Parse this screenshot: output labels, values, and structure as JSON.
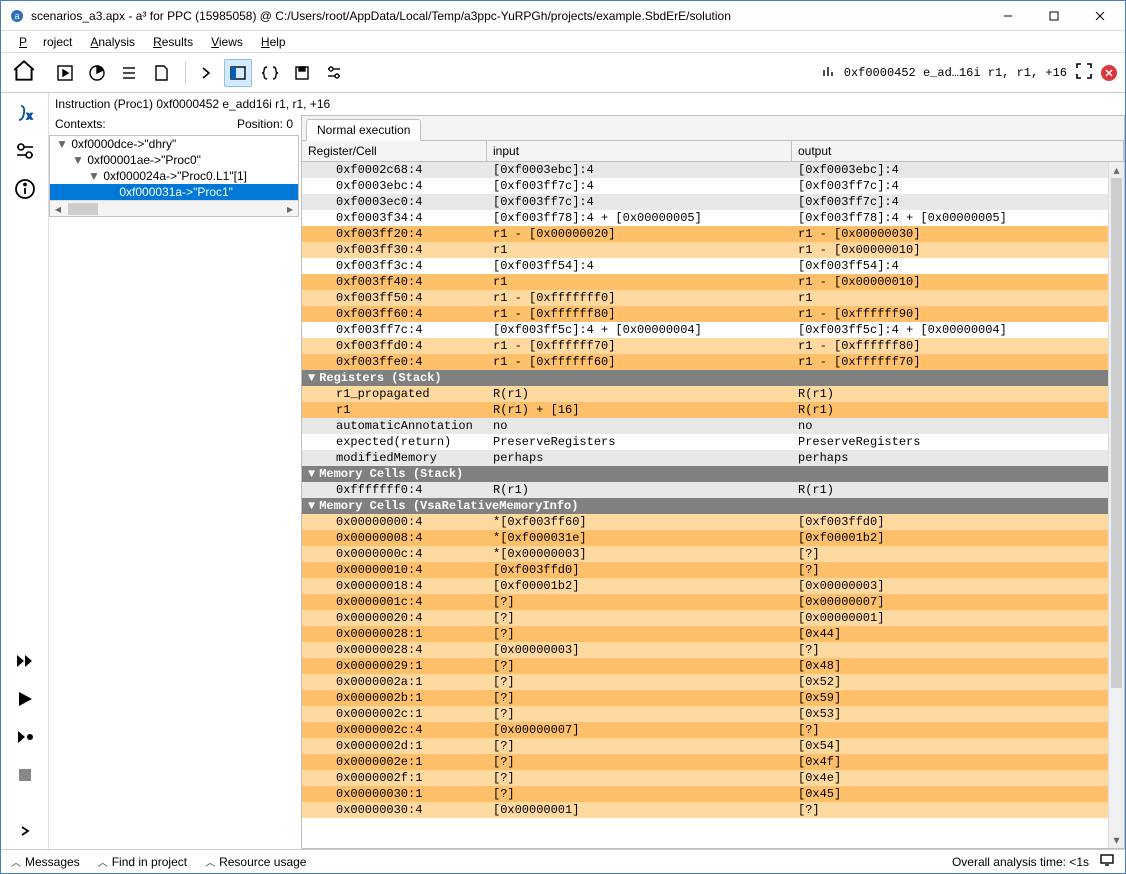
{
  "title": "scenarios_a3.apx - a³ for PPC (15985058) @ C:/Users/root/AppData/Local/Temp/a3ppc-YuRPGh/projects/example.SbdErE/solution",
  "menu": [
    "Project",
    "Analysis",
    "Results",
    "Views",
    "Help"
  ],
  "toolbar_location": "0xf0000452 e_ad…16i r1, r1, +16",
  "instruction": "Instruction (Proc1) 0xf0000452 e_add16i r1, r1, +16",
  "contexts_label": "Contexts:",
  "position_label": "Position: 0",
  "tree": [
    {
      "indent": 0,
      "tw": "▼",
      "label": "0xf0000dce->\"dhry\"",
      "sel": false
    },
    {
      "indent": 1,
      "tw": "▼",
      "label": "0xf00001ae->\"Proc0\"",
      "sel": false
    },
    {
      "indent": 2,
      "tw": "▼",
      "label": "0xf000024a->\"Proc0.L1\"[1]",
      "sel": false
    },
    {
      "indent": 3,
      "tw": "",
      "label": "0xf000031a->\"Proc1\"",
      "sel": true
    }
  ],
  "tab_label": "Normal execution",
  "columns": [
    "Register/Cell",
    "input",
    "output"
  ],
  "rows": [
    {
      "t": "r",
      "cls": "c-lgrey",
      "c": [
        "0xf0002c68:4",
        "[0xf0003ebc]:4",
        "[0xf0003ebc]:4"
      ]
    },
    {
      "t": "r",
      "cls": "c-white",
      "c": [
        "0xf0003ebc:4",
        "[0xf003ff7c]:4",
        "[0xf003ff7c]:4"
      ]
    },
    {
      "t": "r",
      "cls": "c-lgrey",
      "c": [
        "0xf0003ec0:4",
        "[0xf003ff7c]:4",
        "[0xf003ff7c]:4"
      ]
    },
    {
      "t": "r",
      "cls": "c-white",
      "c": [
        "0xf0003f34:4",
        "[0xf003ff78]:4 + [0x00000005]",
        "[0xf003ff78]:4 + [0x00000005]"
      ]
    },
    {
      "t": "r",
      "cls": "c-or1",
      "c": [
        "0xf003ff20:4",
        "r1 - [0x00000020]",
        "r1 - [0x00000030]"
      ]
    },
    {
      "t": "r",
      "cls": "c-or2",
      "c": [
        "0xf003ff30:4",
        "r1",
        "r1 - [0x00000010]"
      ]
    },
    {
      "t": "r",
      "cls": "c-white",
      "c": [
        "0xf003ff3c:4",
        "[0xf003ff54]:4",
        "[0xf003ff54]:4"
      ]
    },
    {
      "t": "r",
      "cls": "c-or1",
      "c": [
        "0xf003ff40:4",
        "r1",
        "r1 - [0x00000010]"
      ]
    },
    {
      "t": "r",
      "cls": "c-or2",
      "c": [
        "0xf003ff50:4",
        "r1 - [0xfffffff0]",
        "r1"
      ]
    },
    {
      "t": "r",
      "cls": "c-or1",
      "c": [
        "0xf003ff60:4",
        "r1 - [0xffffff80]",
        "r1 - [0xffffff90]"
      ]
    },
    {
      "t": "r",
      "cls": "c-white",
      "c": [
        "0xf003ff7c:4",
        "[0xf003ff5c]:4 + [0x00000004]",
        "[0xf003ff5c]:4 + [0x00000004]"
      ]
    },
    {
      "t": "r",
      "cls": "c-or2",
      "c": [
        "0xf003ffd0:4",
        "r1 - [0xffffff70]",
        "r1 - [0xffffff80]"
      ]
    },
    {
      "t": "r",
      "cls": "c-or1",
      "c": [
        "0xf003ffe0:4",
        "r1 - [0xffffff60]",
        "r1 - [0xffffff70]"
      ]
    },
    {
      "t": "s",
      "label": "Registers (Stack)"
    },
    {
      "t": "r",
      "cls": "c-or2",
      "c": [
        "r1_propagated",
        "R(r1)",
        "R(r1)"
      ]
    },
    {
      "t": "r",
      "cls": "c-or1",
      "c": [
        "r1",
        "R(r1) + [16]",
        "R(r1)"
      ]
    },
    {
      "t": "r",
      "cls": "c-lgrey",
      "c": [
        "automaticAnnotation",
        "no",
        "no"
      ]
    },
    {
      "t": "r",
      "cls": "c-white",
      "c": [
        "expected(return)",
        "PreserveRegisters",
        "PreserveRegisters"
      ]
    },
    {
      "t": "r",
      "cls": "c-lgrey",
      "c": [
        "modifiedMemory",
        "perhaps",
        "perhaps"
      ]
    },
    {
      "t": "s",
      "label": "Memory Cells (Stack)"
    },
    {
      "t": "r",
      "cls": "c-lgrey",
      "c": [
        "0xfffffff0:4",
        "R(r1)",
        "R(r1)"
      ]
    },
    {
      "t": "s",
      "label": "Memory Cells (VsaRelativeMemoryInfo)"
    },
    {
      "t": "r",
      "cls": "c-or2",
      "c": [
        "0x00000000:4",
        "*[0xf003ff60]",
        "[0xf003ffd0]"
      ]
    },
    {
      "t": "r",
      "cls": "c-or1",
      "c": [
        "0x00000008:4",
        "*[0xf000031e]",
        "[0xf00001b2]"
      ]
    },
    {
      "t": "r",
      "cls": "c-or2",
      "c": [
        "0x0000000c:4",
        "*[0x00000003]",
        "[?]"
      ]
    },
    {
      "t": "r",
      "cls": "c-or1",
      "c": [
        "0x00000010:4",
        "[0xf003ffd0]",
        "[?]"
      ]
    },
    {
      "t": "r",
      "cls": "c-or2",
      "c": [
        "0x00000018:4",
        "[0xf00001b2]",
        "[0x00000003]"
      ]
    },
    {
      "t": "r",
      "cls": "c-or1",
      "c": [
        "0x0000001c:4",
        "[?]",
        "[0x00000007]"
      ]
    },
    {
      "t": "r",
      "cls": "c-or2",
      "c": [
        "0x00000020:4",
        "[?]",
        "[0x00000001]"
      ]
    },
    {
      "t": "r",
      "cls": "c-or1",
      "c": [
        "0x00000028:1",
        "[?]",
        "[0x44]"
      ]
    },
    {
      "t": "r",
      "cls": "c-or2",
      "c": [
        "0x00000028:4",
        "[0x00000003]",
        "[?]"
      ]
    },
    {
      "t": "r",
      "cls": "c-or1",
      "c": [
        "0x00000029:1",
        "[?]",
        "[0x48]"
      ]
    },
    {
      "t": "r",
      "cls": "c-or2",
      "c": [
        "0x0000002a:1",
        "[?]",
        "[0x52]"
      ]
    },
    {
      "t": "r",
      "cls": "c-or1",
      "c": [
        "0x0000002b:1",
        "[?]",
        "[0x59]"
      ]
    },
    {
      "t": "r",
      "cls": "c-or2",
      "c": [
        "0x0000002c:1",
        "[?]",
        "[0x53]"
      ]
    },
    {
      "t": "r",
      "cls": "c-or1",
      "c": [
        "0x0000002c:4",
        "[0x00000007]",
        "[?]"
      ]
    },
    {
      "t": "r",
      "cls": "c-or2",
      "c": [
        "0x0000002d:1",
        "[?]",
        "[0x54]"
      ]
    },
    {
      "t": "r",
      "cls": "c-or1",
      "c": [
        "0x0000002e:1",
        "[?]",
        "[0x4f]"
      ]
    },
    {
      "t": "r",
      "cls": "c-or2",
      "c": [
        "0x0000002f:1",
        "[?]",
        "[0x4e]"
      ]
    },
    {
      "t": "r",
      "cls": "c-or1",
      "c": [
        "0x00000030:1",
        "[?]",
        "[0x45]"
      ]
    },
    {
      "t": "r",
      "cls": "c-or2",
      "c": [
        "0x00000030:4",
        "[0x00000001]",
        "[?]"
      ]
    }
  ],
  "footer": {
    "messages": "Messages",
    "find": "Find in project",
    "resource": "Resource usage",
    "analysis_time": "Overall analysis time: <1s"
  }
}
